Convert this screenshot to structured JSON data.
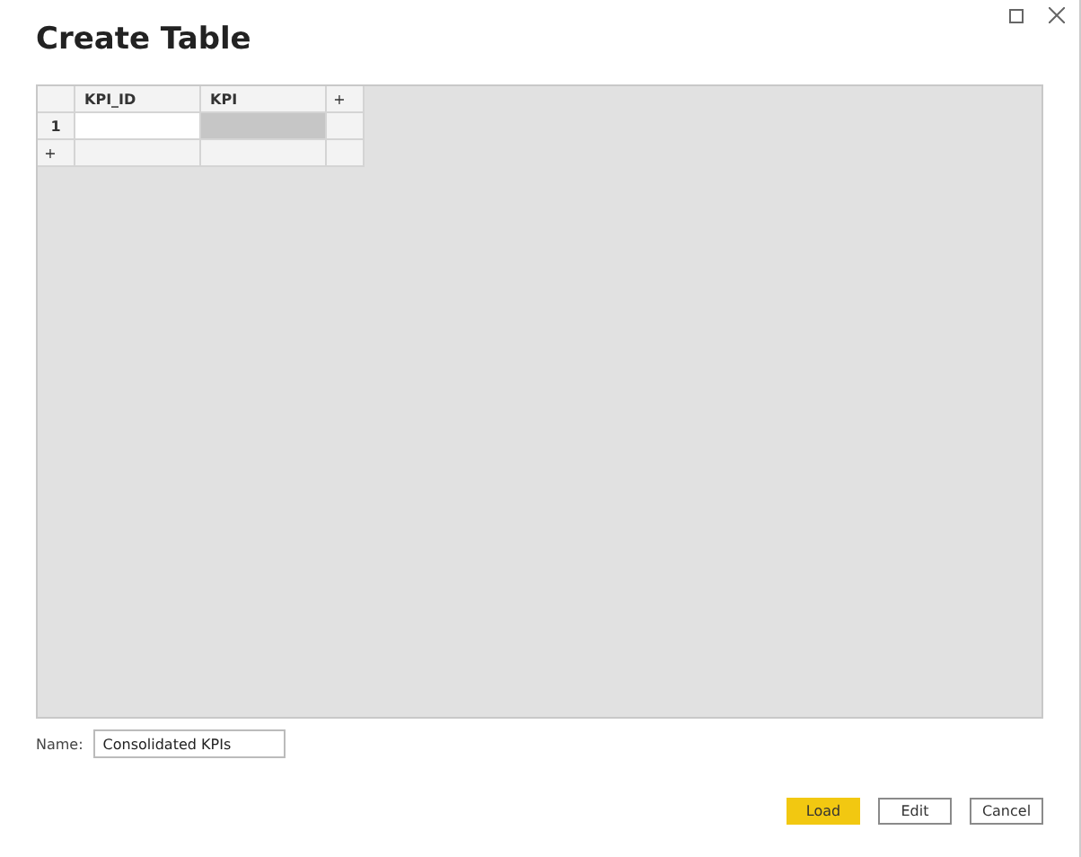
{
  "window": {
    "title": "Create Table"
  },
  "table": {
    "columns": [
      "KPI_ID",
      "KPI"
    ],
    "add_column": "+",
    "add_row": "+",
    "rows": [
      {
        "number": "1",
        "cells": [
          {
            "selected": false
          },
          {
            "selected": true
          }
        ]
      }
    ]
  },
  "name_field": {
    "label": "Name:",
    "value": "Consolidated KPIs"
  },
  "buttons": [
    {
      "label": "Load",
      "primary": true
    },
    {
      "label": "Edit",
      "primary": false
    },
    {
      "label": "Cancel",
      "primary": false
    }
  ]
}
